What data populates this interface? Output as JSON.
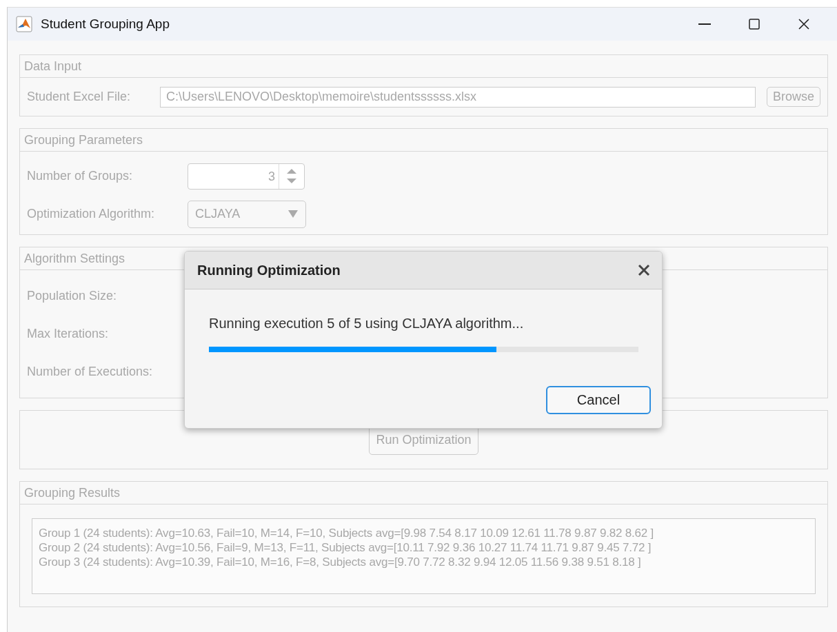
{
  "window": {
    "title": "Student Grouping App"
  },
  "data_input": {
    "title": "Data Input",
    "label": "Student Excel File:",
    "file_field": {
      "value": "C:\\Users\\LENOVO\\Desktop\\memoire\\studentssssss.xlsx",
      "disabled": true
    },
    "browse_button": {
      "label": "Browse",
      "disabled": true
    }
  },
  "grouping_parameters": {
    "title": "Grouping Parameters",
    "groups_label": "Number of Groups:",
    "groups_spinner": {
      "value": "3",
      "disabled": true
    },
    "algorithm_label": "Optimization Algorithm:",
    "algorithm_dropdown": {
      "value": "CLJAYA",
      "disabled": true
    }
  },
  "algorithm_settings": {
    "title": "Algorithm Settings",
    "labels": [
      "Population Size:",
      "Max Iterations:",
      "Number of Executions:"
    ]
  },
  "run_button": {
    "label": "Run Optimization",
    "disabled": true
  },
  "results": {
    "title": "Grouping Results",
    "lines": [
      "Group 1 (24 students): Avg=10.63, Fail=10, M=14, F=10, Subjects avg=[9.98 7.54 8.17 10.09 12.61 11.78 9.87 9.82 8.62 ]",
      "Group 2 (24 students): Avg=10.56, Fail=9, M=13, F=11, Subjects avg=[10.11 7.92 9.36 10.27 11.74 11.71 9.87 9.45 7.72 ]",
      "Group 3 (24 students): Avg=10.39, Fail=10, M=16, F=8, Subjects avg=[9.70 7.72 8.32 9.94 12.05 11.56 9.38 9.51 8.18 ]"
    ]
  },
  "dialog": {
    "title": "Running Optimization",
    "message": "Running execution 5 of 5 using CLJAYA algorithm...",
    "progress": {
      "level": 0.67
    },
    "cancel_button": "Cancel"
  }
}
